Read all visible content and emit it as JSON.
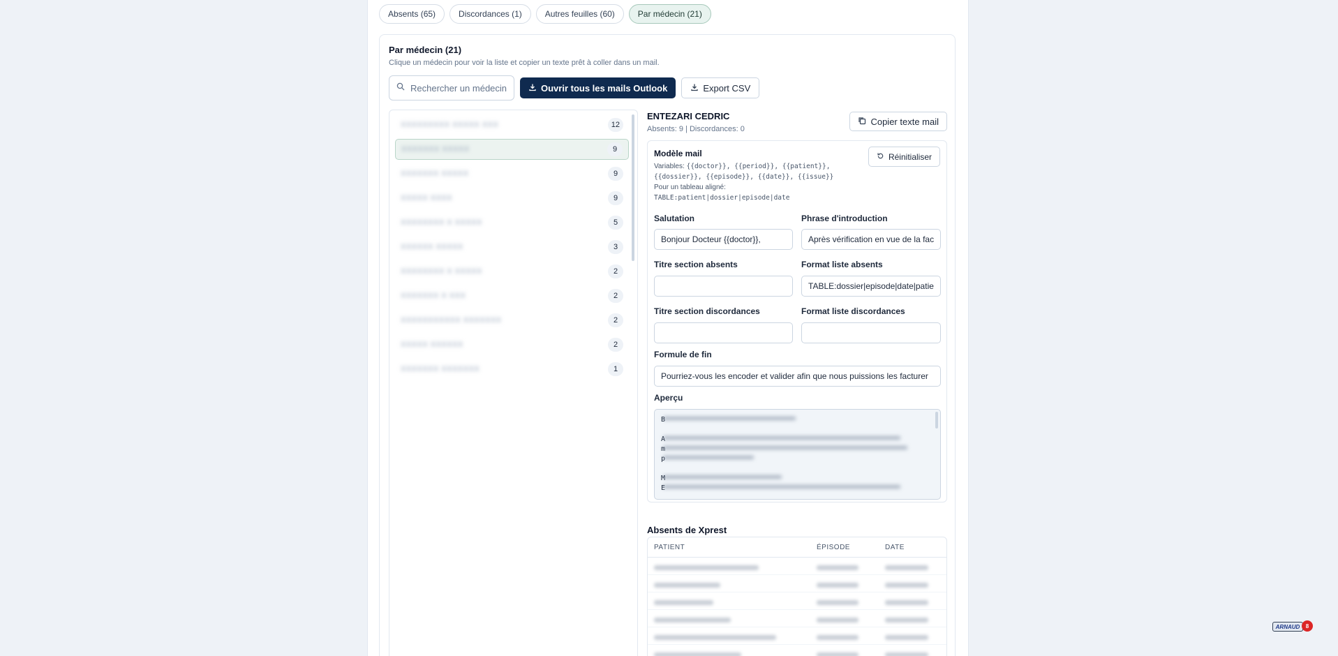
{
  "tabs": [
    {
      "label": "Absents (65)"
    },
    {
      "label": "Discordances (1)"
    },
    {
      "label": "Autres feuilles (60)"
    },
    {
      "label": "Par médecin (21)"
    }
  ],
  "panel": {
    "title": "Par médecin (21)",
    "subtitle": "Clique un médecin pour voir la liste et copier un texte prêt à coller dans un mail.",
    "search_placeholder": "Rechercher un médecin",
    "open_all_label": "Ouvrir tous les mails Outlook",
    "export_label": "Export CSV"
  },
  "doctors": [
    {
      "name": "XXXXXXXXX XXXXX XXX",
      "count": "12"
    },
    {
      "name": "XXXXXXX XXXXX",
      "count": "9"
    },
    {
      "name": "XXXXXXX XXXXX",
      "count": "9"
    },
    {
      "name": "XXXXX XXXX",
      "count": "9"
    },
    {
      "name": "XXXXXXXX X XXXXX",
      "count": "5"
    },
    {
      "name": "XXXXXX XXXXX",
      "count": "3"
    },
    {
      "name": "XXXXXXXX X XXXXX",
      "count": "2"
    },
    {
      "name": "XXXXXXX X XXX",
      "count": "2"
    },
    {
      "name": "XXXXXXXXXXX XXXXXXX",
      "count": "2"
    },
    {
      "name": "XXXXX XXXXXX",
      "count": "2"
    },
    {
      "name": "XXXXXXX XXXXXXX",
      "count": "1"
    }
  ],
  "detail": {
    "name": "ENTEZARI CEDRIC",
    "stats": "Absents: 9 | Discordances: 0",
    "copy_label": "Copier texte mail"
  },
  "template": {
    "title": "Modèle mail",
    "variables_label": "Variables:",
    "variables": "{{doctor}}, {{period}}, {{patient}}, {{dossier}}, {{episode}}, {{date}}, {{issue}}",
    "table_hint": "Pour un tableau aligné:",
    "table_example": "TABLE:patient|dossier|episode|date",
    "reset_label": "Réinitialiser",
    "salutation_label": "Salutation",
    "salutation_value": "Bonjour Docteur {{doctor}},",
    "intro_label": "Phrase d'introduction",
    "intro_value": "Après vérification en vue de la facturation",
    "abs_title_label": "Titre section absents",
    "abs_title_value": "",
    "abs_format_label": "Format liste absents",
    "abs_format_value": "TABLE:dossier|episode|date|patient",
    "disc_title_label": "Titre section discordances",
    "disc_title_value": "",
    "disc_format_label": "Format liste discordances",
    "disc_format_value": "",
    "closing_label": "Formule de fin",
    "closing_value": "Pourriez-vous les encoder et valider afin que nous puissions les facturer",
    "preview_label": "Aperçu",
    "preview_visible": "B\n\nA\nm\np\n\nM\nE"
  },
  "absents": {
    "title": "Absents de Xprest",
    "columns": [
      "PATIENT",
      "ÉPISODE",
      "DATE"
    ]
  },
  "logo": {
    "text": "ARNAUD",
    "badge": "8"
  }
}
